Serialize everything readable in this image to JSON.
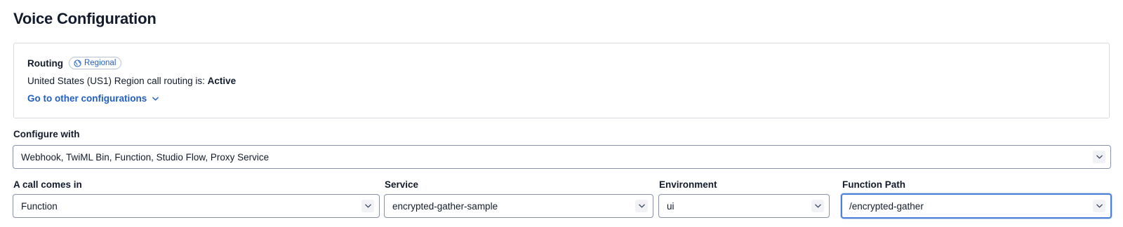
{
  "page": {
    "title": "Voice Configuration"
  },
  "routing": {
    "title": "Routing",
    "badge": "Regional",
    "status_prefix": "United States (US1) Region call routing is: ",
    "status_value": "Active",
    "other_config_link": "Go to other configurations"
  },
  "configure_with": {
    "label": "Configure with",
    "value": "Webhook, TwiML Bin, Function, Studio Flow, Proxy Service"
  },
  "call_comes_in": {
    "label": "A call comes in",
    "value": "Function"
  },
  "service": {
    "label": "Service",
    "value": "encrypted-gather-sample"
  },
  "environment": {
    "label": "Environment",
    "value": "ui"
  },
  "function_path": {
    "label": "Function Path",
    "value": "/encrypted-gather"
  },
  "colors": {
    "link": "#1f5fc7",
    "border": "#8891aa",
    "focus": "#4a80d9",
    "text": "#121c2d"
  },
  "icons": {
    "badge_icon": "globe-icon",
    "dropdown_icon": "chevron-down-icon"
  }
}
